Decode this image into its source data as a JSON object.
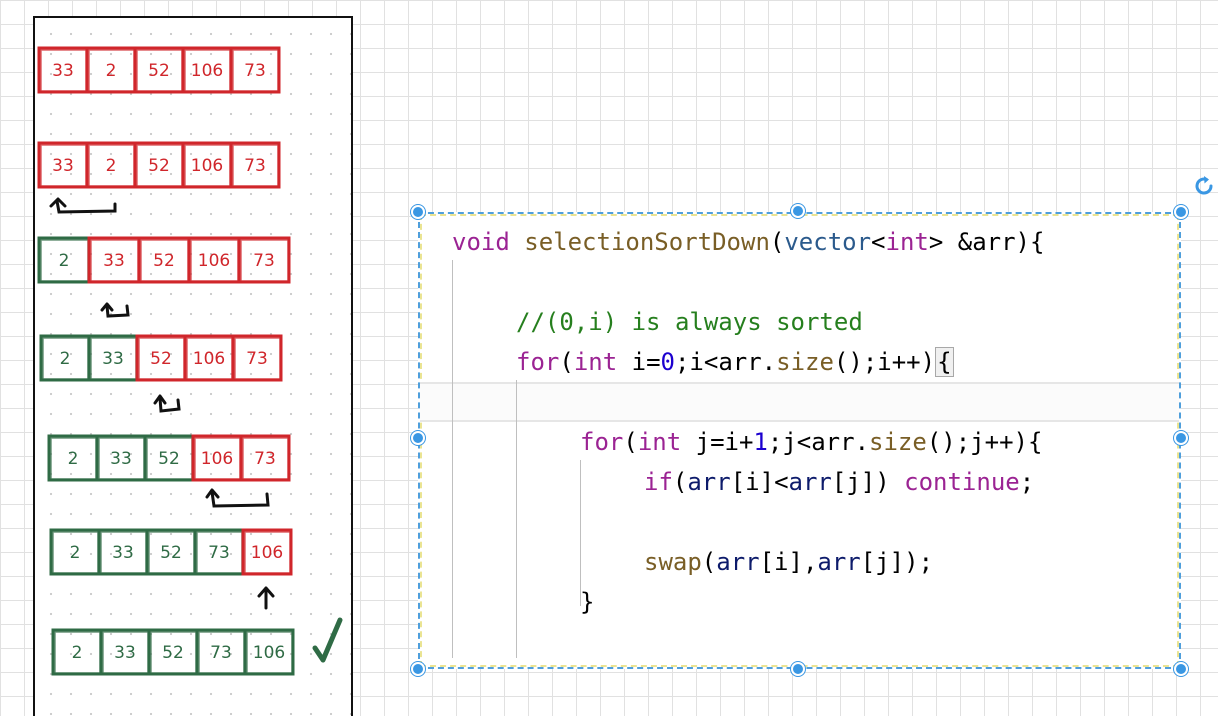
{
  "sketch": {
    "rows": [
      {
        "cells": [
          {
            "value": "33",
            "color": "red"
          },
          {
            "value": "2",
            "color": "red"
          },
          {
            "value": "52",
            "color": "red"
          },
          {
            "value": "106",
            "color": "red"
          },
          {
            "value": "73",
            "color": "red"
          }
        ]
      },
      {
        "cells": [
          {
            "value": "33",
            "color": "red"
          },
          {
            "value": "2",
            "color": "red"
          },
          {
            "value": "52",
            "color": "red"
          },
          {
            "value": "106",
            "color": "red"
          },
          {
            "value": "73",
            "color": "red"
          }
        ]
      },
      {
        "cells": [
          {
            "value": "2",
            "color": "green"
          },
          {
            "value": "33",
            "color": "red"
          },
          {
            "value": "52",
            "color": "red"
          },
          {
            "value": "106",
            "color": "red"
          },
          {
            "value": "73",
            "color": "red"
          }
        ]
      },
      {
        "cells": [
          {
            "value": "2",
            "color": "green"
          },
          {
            "value": "33",
            "color": "green"
          },
          {
            "value": "52",
            "color": "red"
          },
          {
            "value": "106",
            "color": "red"
          },
          {
            "value": "73",
            "color": "red"
          }
        ]
      },
      {
        "cells": [
          {
            "value": "2",
            "color": "green"
          },
          {
            "value": "33",
            "color": "green"
          },
          {
            "value": "52",
            "color": "green"
          },
          {
            "value": "106",
            "color": "red"
          },
          {
            "value": "73",
            "color": "red"
          }
        ]
      },
      {
        "cells": [
          {
            "value": "2",
            "color": "green"
          },
          {
            "value": "33",
            "color": "green"
          },
          {
            "value": "52",
            "color": "green"
          },
          {
            "value": "73",
            "color": "green"
          },
          {
            "value": "106",
            "color": "red"
          }
        ]
      },
      {
        "cells": [
          {
            "value": "2",
            "color": "green"
          },
          {
            "value": "33",
            "color": "green"
          },
          {
            "value": "52",
            "color": "green"
          },
          {
            "value": "73",
            "color": "green"
          },
          {
            "value": "106",
            "color": "green"
          }
        ]
      }
    ],
    "colors": {
      "red": "#d0262b",
      "green": "#2f6b45",
      "ink": "#111111"
    }
  },
  "code": {
    "line1": {
      "kw": "void",
      "fn": "selectionSortDown",
      "p1": "(",
      "ty": "vector",
      "lt": "<",
      "ty2": "int",
      "gt": ">",
      "rest": " &arr){"
    },
    "line2": {
      "comment": "//(0,i) is always sorted"
    },
    "line3": {
      "kw": "for",
      "p1": "(",
      "ty": "int",
      "a": " i=",
      "n0": "0",
      "b": ";i<arr.",
      "fn": "size",
      "c": "();i++)",
      "brace": "{"
    },
    "line4": {
      "kw": "for",
      "p1": "(",
      "ty": "int",
      "a": " j=i+",
      "n1": "1",
      "b": ";j<arr.",
      "fn": "size",
      "c": "();j++){"
    },
    "line5": {
      "kw": "if",
      "a": "(",
      "v1": "arr",
      "b": "[i]<",
      "v2": "arr",
      "c": "[j]) ",
      "kw2": "continue",
      "d": ";"
    },
    "line6": {
      "fn": "swap",
      "a": "(",
      "v1": "arr",
      "b": "[i],",
      "v2": "arr",
      "c": "[j]);"
    },
    "line7": {
      "a": "}"
    }
  },
  "selection_colors": {
    "handle": "#3a97e3",
    "border": "#4f9fdc"
  }
}
